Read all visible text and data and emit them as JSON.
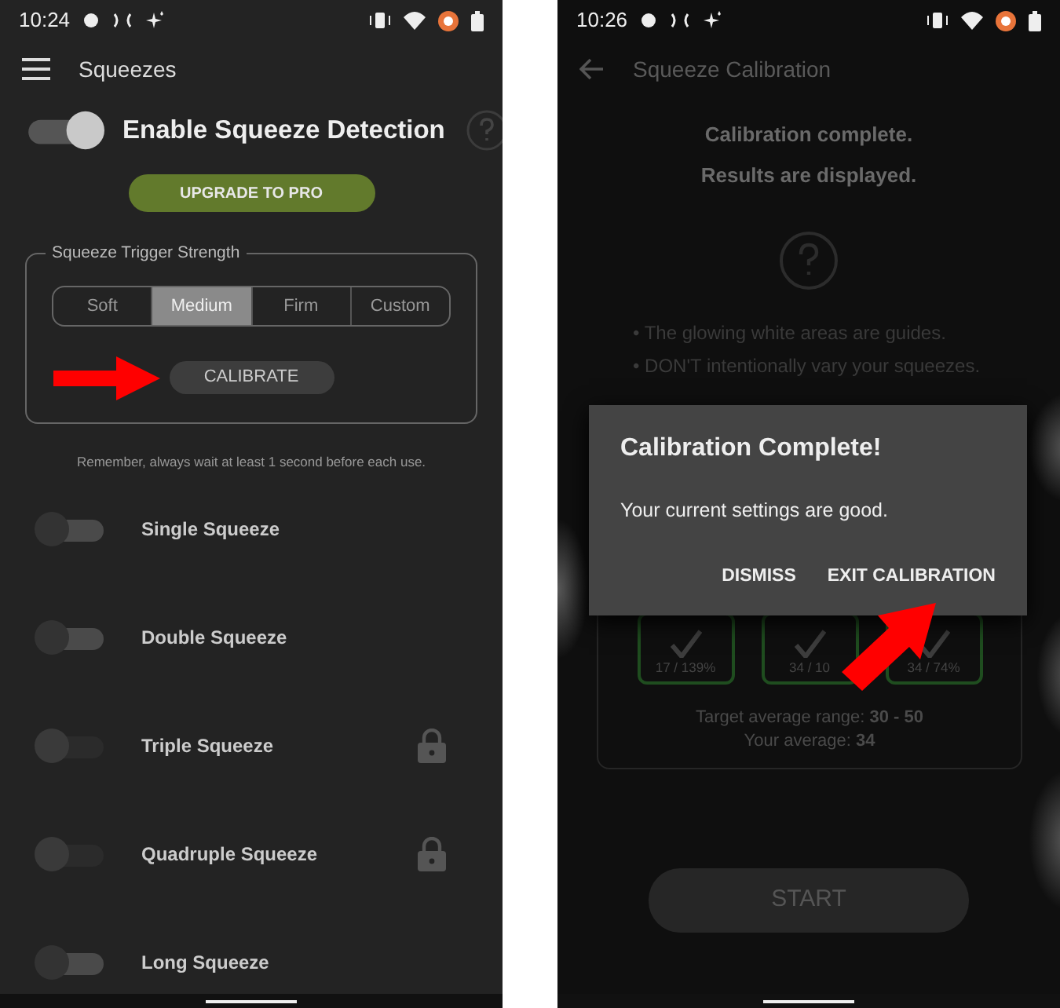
{
  "left_screen": {
    "status_bar": {
      "time": "10:24"
    },
    "toolbar": {
      "title": "Squeezes"
    },
    "enable": {
      "label": "Enable Squeeze Detection",
      "on": true
    },
    "upgrade_button": "UPGRADE TO PRO",
    "strength": {
      "legend": "Squeeze Trigger Strength",
      "options": [
        {
          "label": "Soft",
          "selected": false
        },
        {
          "label": "Medium",
          "selected": true
        },
        {
          "label": "Firm",
          "selected": false
        },
        {
          "label": "Custom",
          "selected": false
        }
      ],
      "calibrate_button": "CALIBRATE"
    },
    "note": "Remember, always wait at least 1 second before each use.",
    "gestures": [
      {
        "label": "Single Squeeze",
        "on": false,
        "locked": false
      },
      {
        "label": "Double Squeeze",
        "on": false,
        "locked": false
      },
      {
        "label": "Triple Squeeze",
        "on": false,
        "locked": true
      },
      {
        "label": "Quadruple Squeeze",
        "on": false,
        "locked": true
      },
      {
        "label": "Long Squeeze",
        "on": false,
        "locked": false
      }
    ]
  },
  "right_screen": {
    "status_bar": {
      "time": "10:26"
    },
    "toolbar": {
      "title": "Squeeze Calibration"
    },
    "messages": [
      "Calibration complete.",
      "Results are displayed."
    ],
    "tips": [
      "• The glowing white areas are guides.",
      "• DON'T intentionally vary your squeezes."
    ],
    "results": [
      {
        "reading": "17 / 139%"
      },
      {
        "reading": "34 / 10"
      },
      {
        "reading": "34 / 74%"
      }
    ],
    "target": "Target average range: **30 - 50**",
    "average": "Your average: **34**",
    "start_button": "START",
    "dialog": {
      "title": "Calibration Complete!",
      "message": "Your current settings are good.",
      "buttons": [
        "DISMISS",
        "EXIT CALIBRATION"
      ]
    }
  }
}
